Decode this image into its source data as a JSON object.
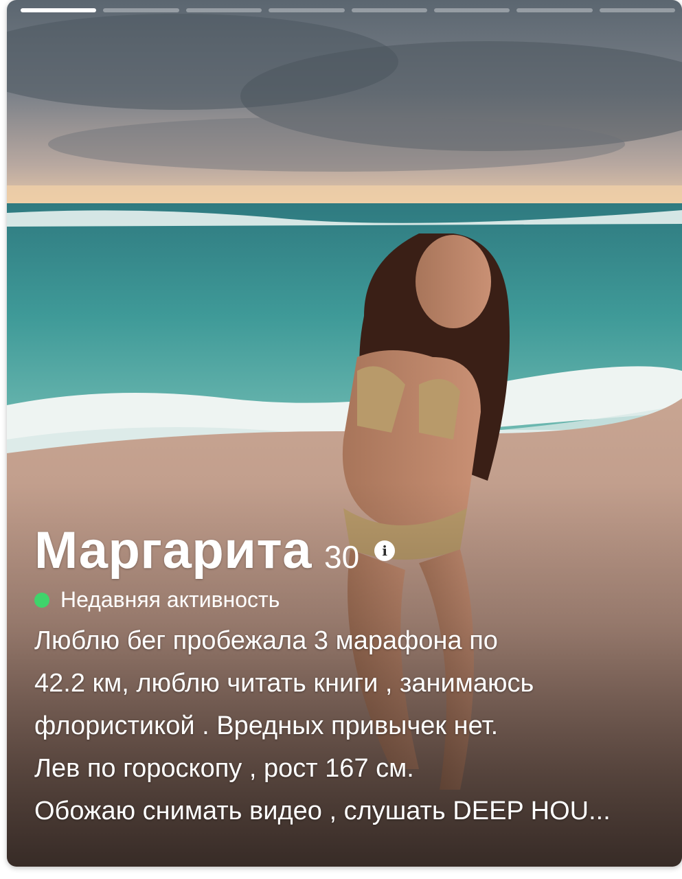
{
  "progress": {
    "total": 8,
    "active_index": 0
  },
  "profile": {
    "name": "Маргарита",
    "age": "30",
    "info_icon": "info-icon",
    "status": "Недавняя активность",
    "status_color": "#3fd46b",
    "bio_lines": [
      "Люблю бег пробежала 3 марафона по",
      "42.2 км, люблю читать книги , занимаюсь",
      "флористикой . Вредных привычек нет.",
      "Лев по гороскопу , рост 167 см.",
      "Обожаю снимать видео , слушать DEEP HOU..."
    ]
  }
}
